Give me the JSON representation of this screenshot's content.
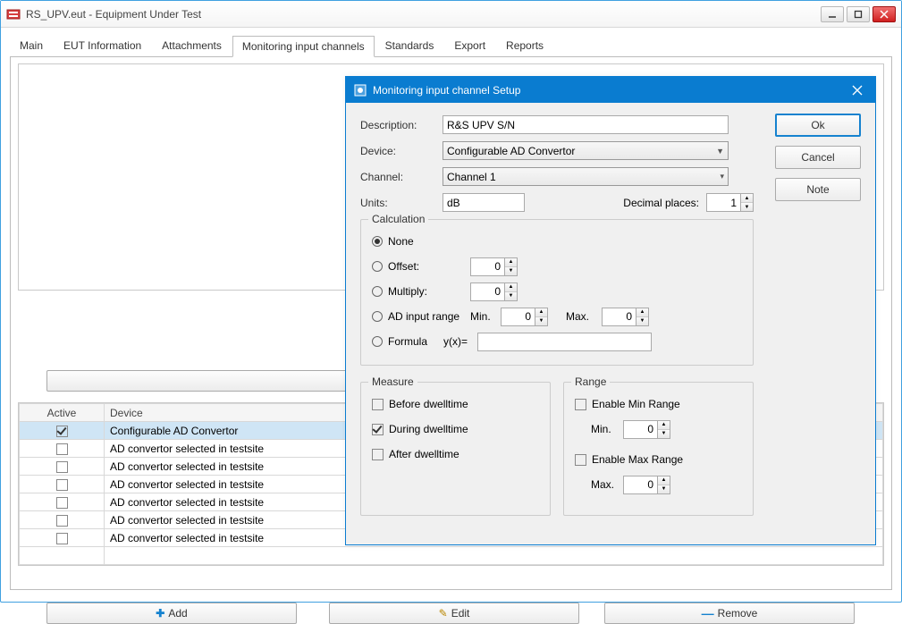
{
  "window": {
    "title": "RS_UPV.eut - Equipment Under Test"
  },
  "tabs": [
    "Main",
    "EUT Information",
    "Attachments",
    "Monitoring input channels",
    "Standards",
    "Export",
    "Reports"
  ],
  "active_tab": 3,
  "buttons": {
    "add": "Add",
    "edit": "Edit",
    "remove": "Remove"
  },
  "table": {
    "headers": {
      "active": "Active",
      "device": "Device"
    },
    "rows": [
      {
        "active": true,
        "device": "Configurable AD Convertor",
        "selected": true
      },
      {
        "active": false,
        "device": "AD convertor selected in testsite"
      },
      {
        "active": false,
        "device": "AD convertor selected in testsite"
      },
      {
        "active": false,
        "device": "AD convertor selected in testsite"
      },
      {
        "active": false,
        "device": "AD convertor selected in testsite"
      },
      {
        "active": false,
        "device": "AD convertor selected in testsite"
      },
      {
        "active": false,
        "device": "AD convertor selected in testsite"
      }
    ]
  },
  "dialog": {
    "title": "Monitoring input channel Setup",
    "labels": {
      "description": "Description:",
      "device": "Device:",
      "channel": "Channel:",
      "units": "Units:",
      "decimal": "Decimal places:"
    },
    "values": {
      "description": "R&S UPV S/N",
      "device": "Configurable AD Convertor",
      "channel": "Channel 1",
      "units": "dB",
      "decimal": "1"
    },
    "calc": {
      "legend": "Calculation",
      "none": "None",
      "offset": "Offset:",
      "multiply": "Multiply:",
      "adrange": "AD input range",
      "min": "Min.",
      "max": "Max.",
      "formula": "Formula",
      "yx": "y(x)=",
      "offset_val": "0",
      "multiply_val": "0",
      "min_val": "0",
      "max_val": "0"
    },
    "measure": {
      "legend": "Measure",
      "before": "Before dwelltime",
      "during": "During dwelltime",
      "after": "After dwelltime"
    },
    "range": {
      "legend": "Range",
      "enable_min": "Enable Min Range",
      "enable_max": "Enable Max Range",
      "min": "Min.",
      "max": "Max.",
      "min_val": "0",
      "max_val": "0"
    },
    "btns": {
      "ok": "Ok",
      "cancel": "Cancel",
      "note": "Note"
    }
  }
}
